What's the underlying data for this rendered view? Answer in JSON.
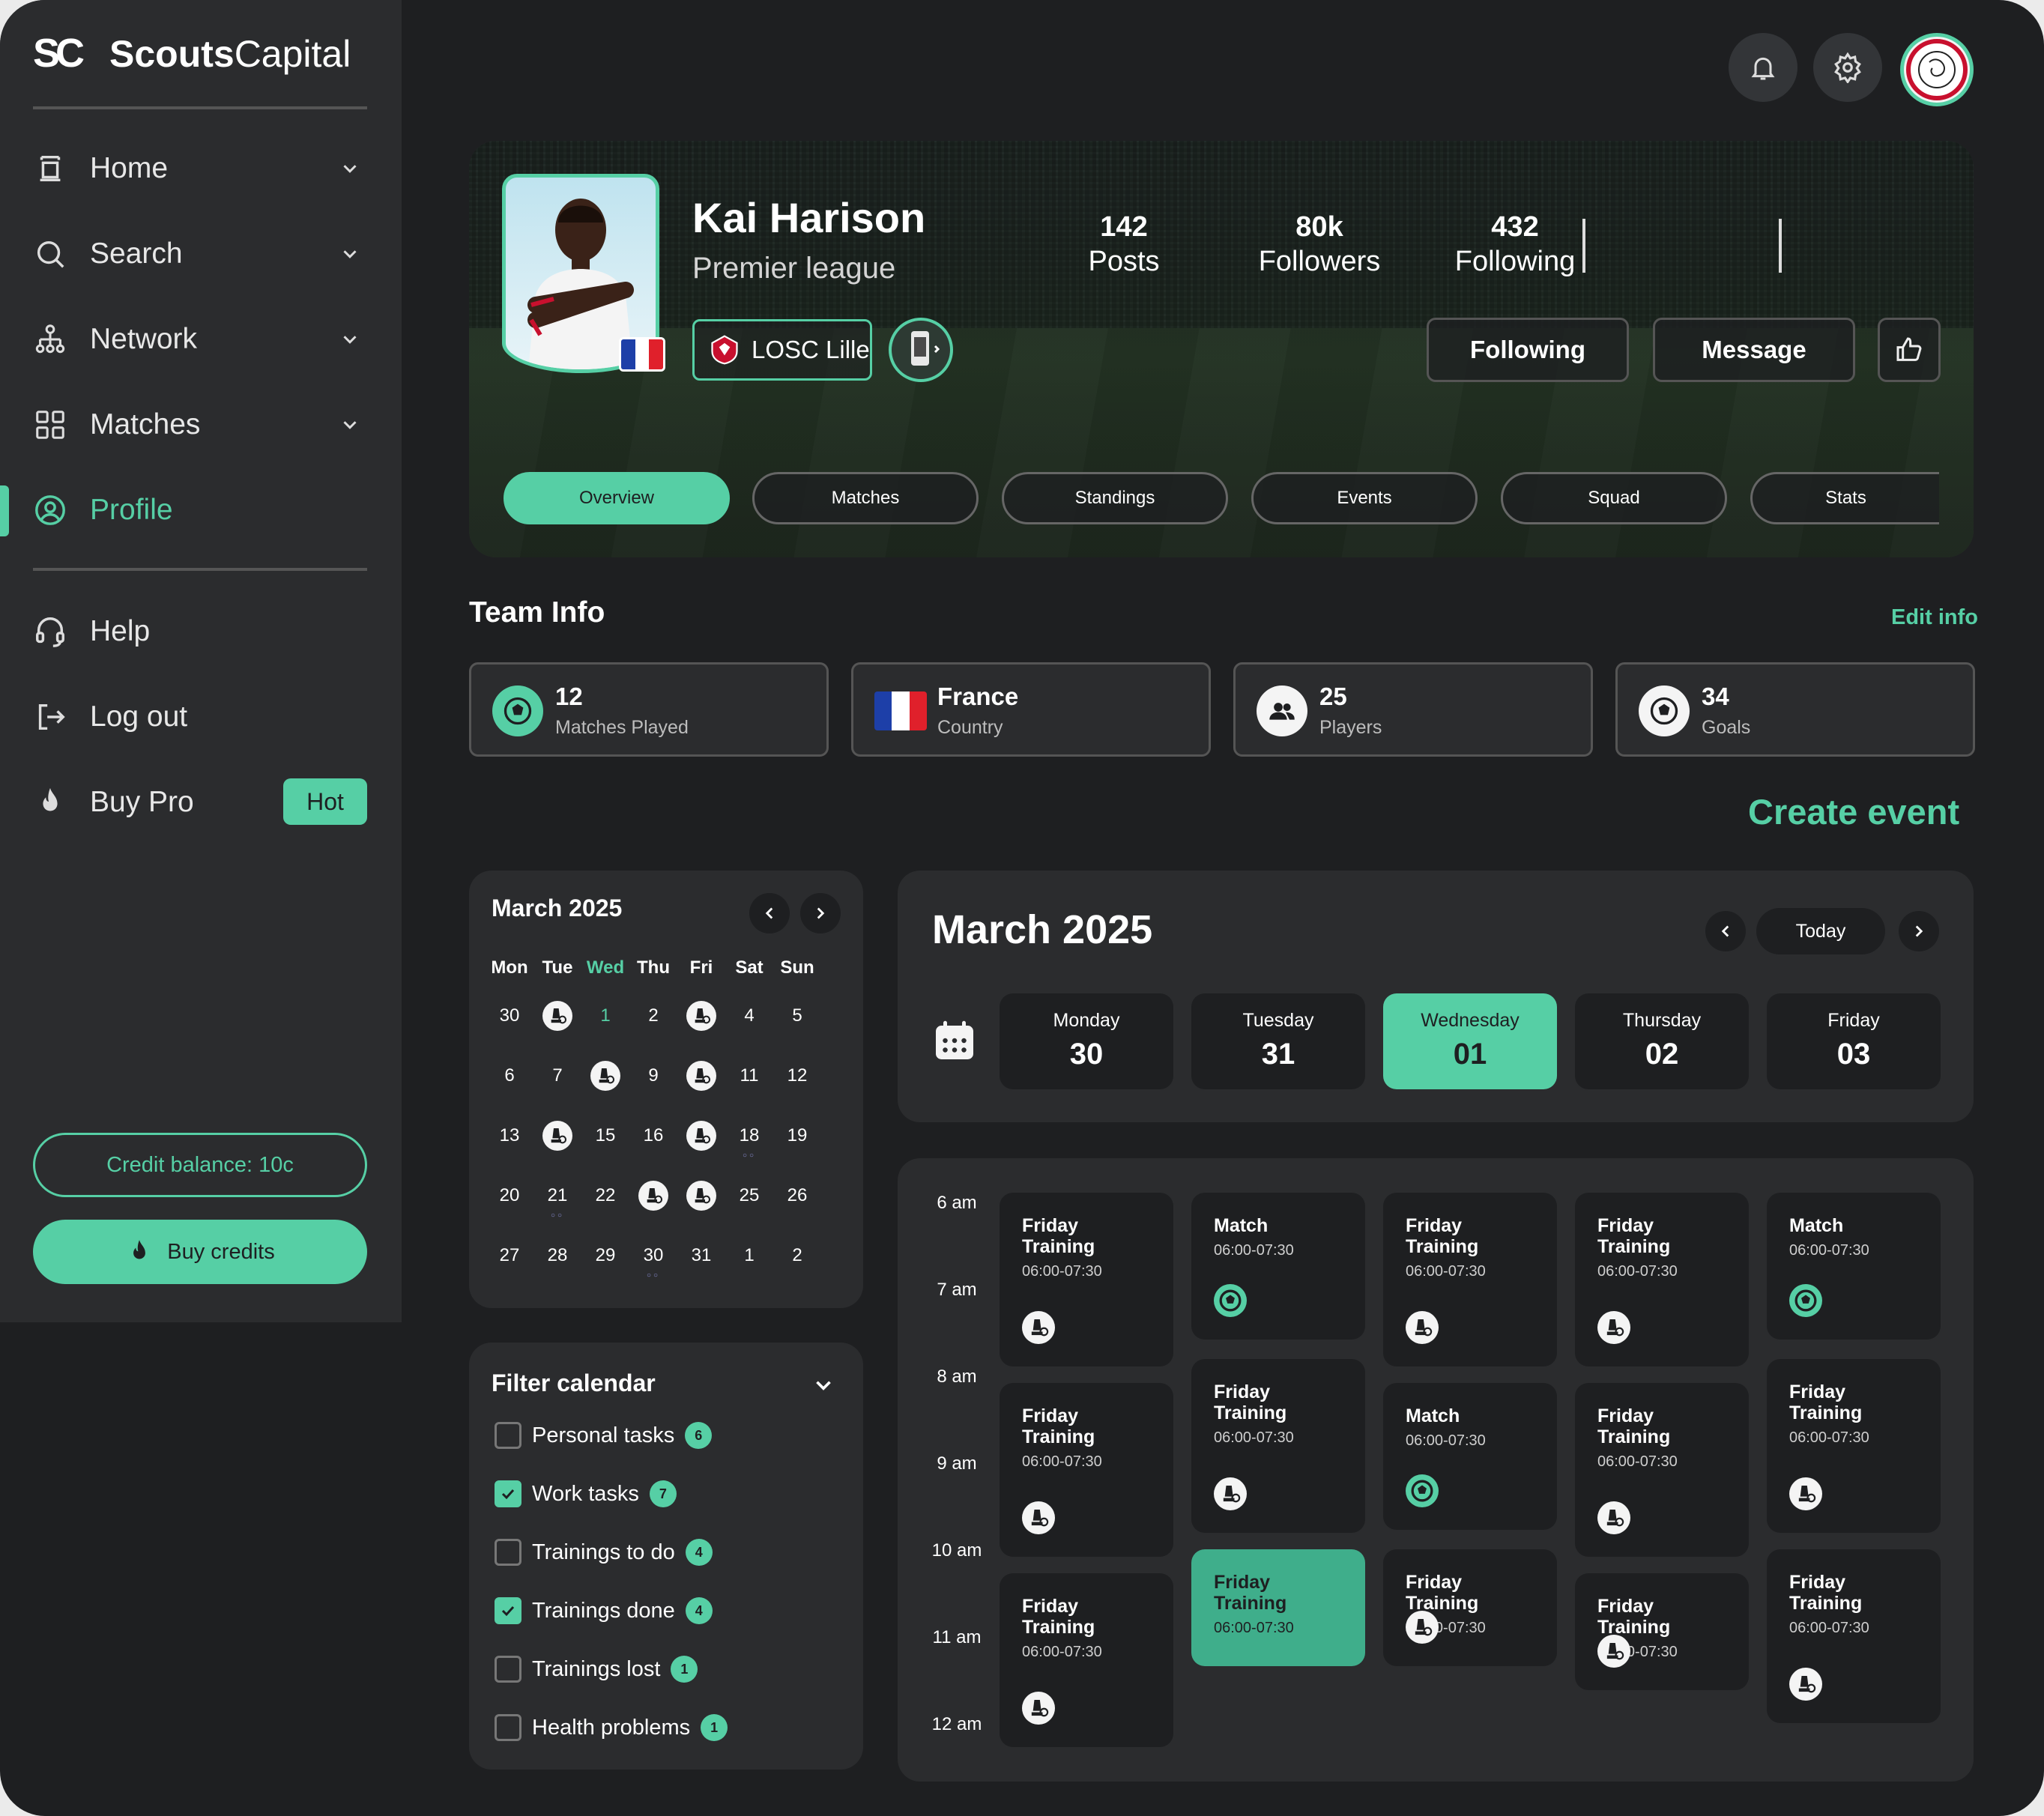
{
  "brand": {
    "mark": "SC",
    "name_bold": "Scouts",
    "name_light": "Capital"
  },
  "nav": {
    "items": [
      {
        "label": "Home",
        "icon": "home-icon"
      },
      {
        "label": "Search",
        "icon": "search-icon"
      },
      {
        "label": "Network",
        "icon": "network-icon"
      },
      {
        "label": "Matches",
        "icon": "grid-icon"
      },
      {
        "label": "Profile",
        "icon": "profile-icon"
      }
    ],
    "secondary": [
      {
        "label": "Help",
        "icon": "headset-icon"
      },
      {
        "label": "Log out",
        "icon": "logout-icon"
      },
      {
        "label": "Buy Pro",
        "icon": "fire-icon",
        "badge": "Hot"
      }
    ],
    "credit_balance": "Credit balance: 10c",
    "buy_credits": "Buy credits"
  },
  "player": {
    "name": "Kai Harison",
    "league": "Premier league",
    "club": "LOSC Lille",
    "stats": [
      {
        "value": "142",
        "label": "Posts"
      },
      {
        "value": "80k",
        "label": "Followers"
      },
      {
        "value": "432",
        "label": "Following"
      }
    ],
    "following_btn": "Following",
    "message_btn": "Message"
  },
  "tabs": [
    "Overview",
    "Matches",
    "Standings",
    "Events",
    "Squad",
    "Stats"
  ],
  "team_info": {
    "title": "Team Info",
    "edit": "Edit info",
    "cards": [
      {
        "value": "12",
        "label": "Matches Played"
      },
      {
        "value": "France",
        "label": "Country"
      },
      {
        "value": "25",
        "label": "Players"
      },
      {
        "value": "34",
        "label": "Goals"
      }
    ]
  },
  "create_event": "Create event",
  "mini_calendar": {
    "title": "March 2025",
    "dow": [
      "Mon",
      "Tue",
      "Wed",
      "Thu",
      "Fri",
      "Sat",
      "Sun"
    ],
    "weeks": [
      [
        "30",
        "",
        "1",
        "2",
        "",
        "4",
        "5"
      ],
      [
        "6",
        "7",
        "",
        "9",
        "",
        "11",
        "12"
      ],
      [
        "13",
        "",
        "15",
        "16",
        "",
        "18",
        "19"
      ],
      [
        "20",
        "21",
        "22",
        "",
        "",
        "25",
        "26"
      ],
      [
        "27",
        "28",
        "29",
        "30",
        "31",
        "1",
        "2"
      ]
    ]
  },
  "filter": {
    "title": "Filter calendar",
    "items": [
      {
        "label": "Personal tasks",
        "count": "6",
        "checked": false
      },
      {
        "label": "Work tasks",
        "count": "7",
        "checked": true
      },
      {
        "label": "Trainings to do",
        "count": "4",
        "checked": false
      },
      {
        "label": "Trainings done",
        "count": "4",
        "checked": true
      },
      {
        "label": "Trainings lost",
        "count": "1",
        "checked": false
      },
      {
        "label": "Health problems",
        "count": "1",
        "checked": false
      }
    ]
  },
  "week_calendar": {
    "title": "March 2025",
    "today": "Today",
    "days": [
      {
        "name": "Monday",
        "num": "30"
      },
      {
        "name": "Tuesday",
        "num": "31"
      },
      {
        "name": "Wednesday",
        "num": "01"
      },
      {
        "name": "Thursday",
        "num": "02"
      },
      {
        "name": "Friday",
        "num": "03"
      }
    ],
    "hours": [
      "6 am",
      "7 am",
      "8 am",
      "9 am",
      "10 am",
      "11 am",
      "12 am"
    ],
    "event_training": "Friday Training",
    "event_match": "Match",
    "event_time": "06:00-07:30"
  },
  "colors": {
    "accent": "#56cfa5",
    "bg": "#1e1f21",
    "panel": "#2b2c2e"
  }
}
